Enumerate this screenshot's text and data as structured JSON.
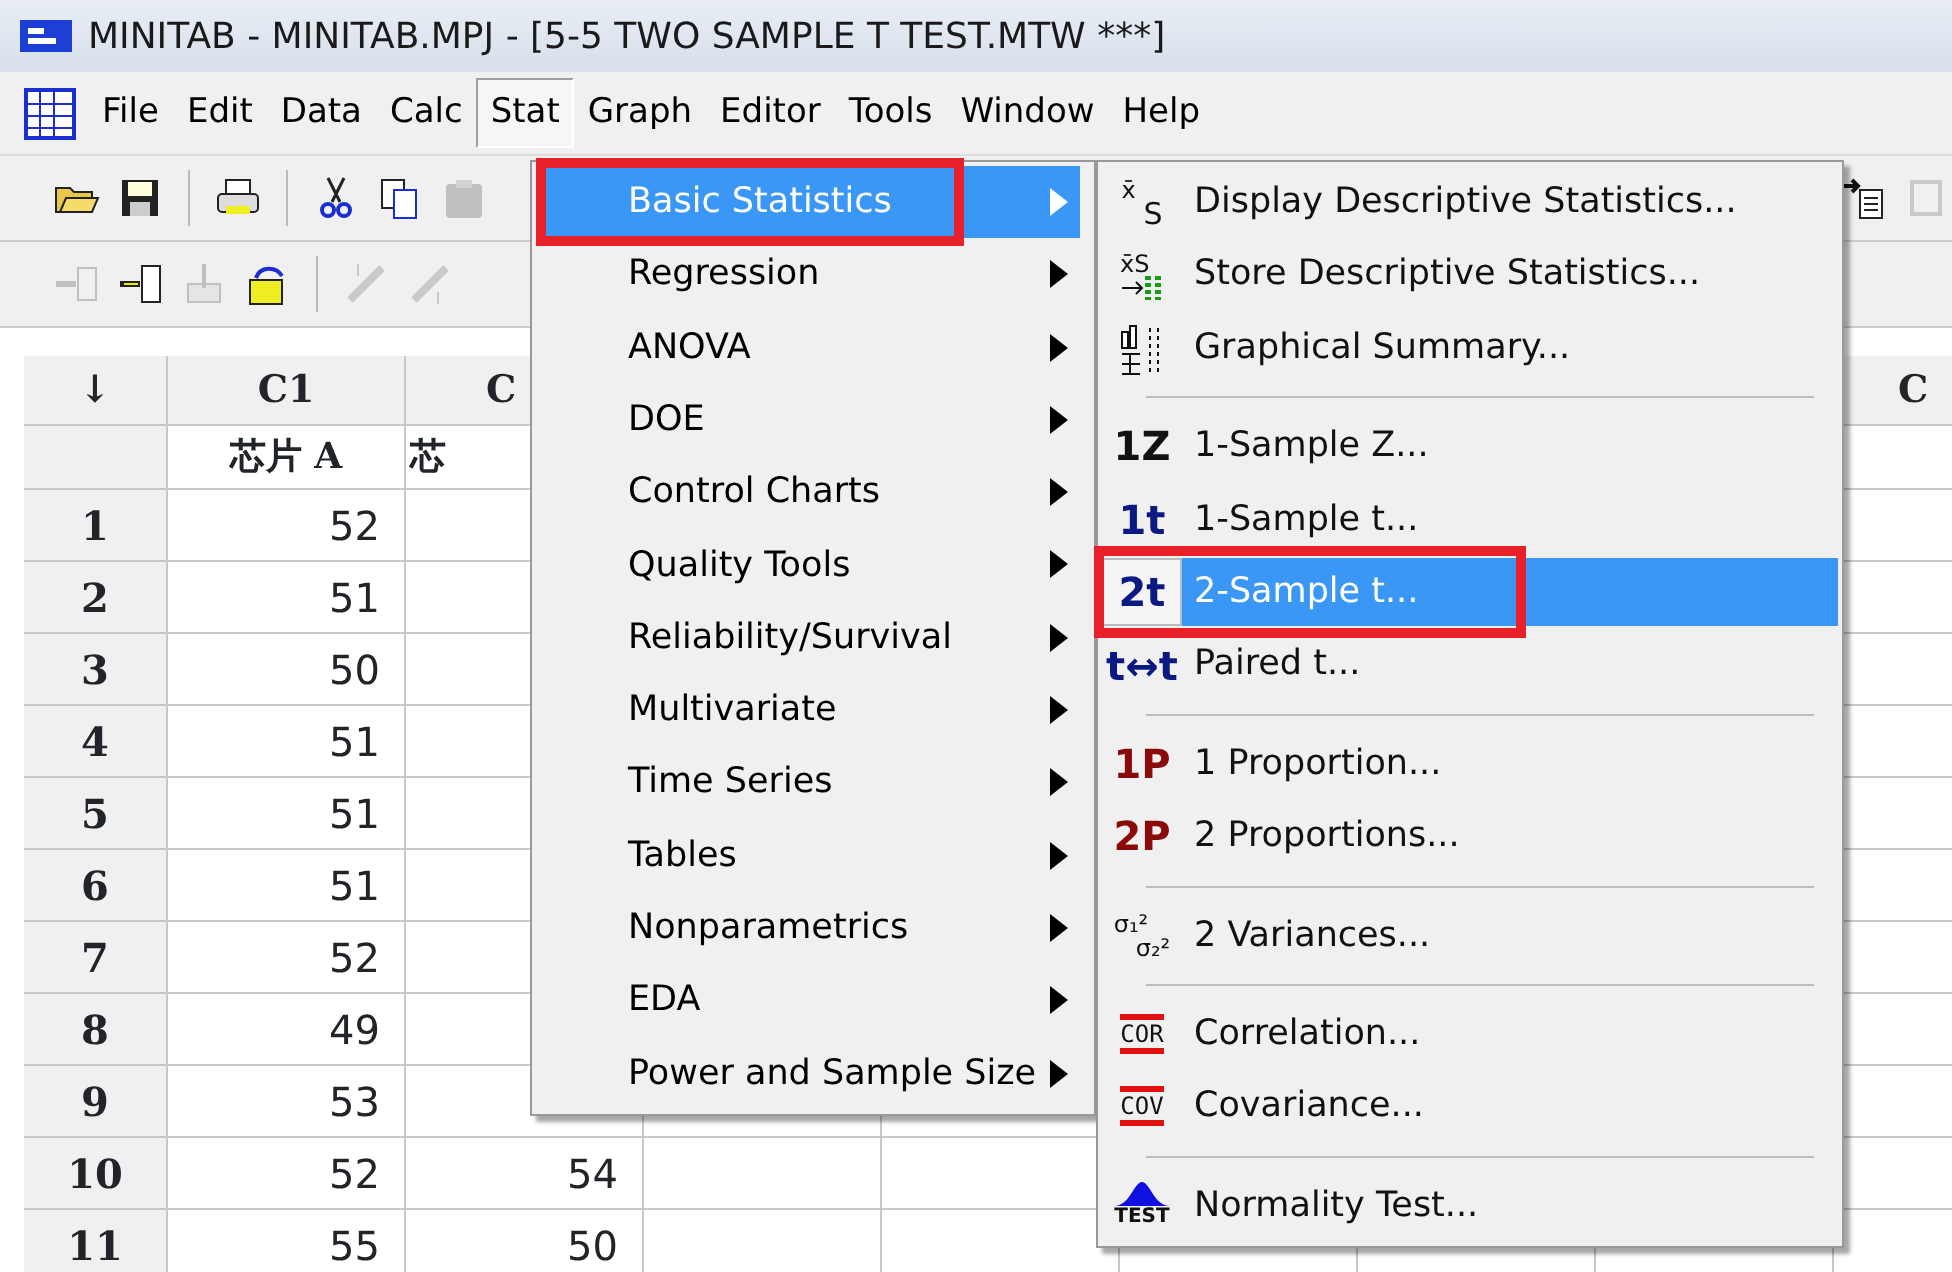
{
  "window": {
    "title": "MINITAB - MINITAB.MPJ - [5-5 TWO SAMPLE T TEST.MTW ***]"
  },
  "menubar": [
    {
      "label": "File",
      "selected": false
    },
    {
      "label": "Edit",
      "selected": false
    },
    {
      "label": "Data",
      "selected": false
    },
    {
      "label": "Calc",
      "selected": false
    },
    {
      "label": "Stat",
      "selected": true
    },
    {
      "label": "Graph",
      "selected": false
    },
    {
      "label": "Editor",
      "selected": false
    },
    {
      "label": "Tools",
      "selected": false
    },
    {
      "label": "Window",
      "selected": false
    },
    {
      "label": "Help",
      "selected": false
    }
  ],
  "toolbar_1": [
    {
      "kind": "open",
      "disabled": false
    },
    {
      "kind": "save",
      "disabled": false
    },
    {
      "kind": "separator"
    },
    {
      "kind": "print",
      "disabled": false
    },
    {
      "kind": "separator"
    },
    {
      "kind": "cut",
      "disabled": false
    },
    {
      "kind": "copy",
      "disabled": false
    },
    {
      "kind": "paste",
      "disabled": true
    }
  ],
  "toolbar_1_right": [
    {
      "kind": "output",
      "disabled": false
    },
    {
      "kind": "frame",
      "disabled": true
    }
  ],
  "toolbar_2": [
    {
      "kind": "insert-row",
      "disabled": true
    },
    {
      "kind": "insert-column",
      "disabled": false
    },
    {
      "kind": "move-down",
      "disabled": true
    },
    {
      "kind": "rotate",
      "disabled": false
    },
    {
      "kind": "separator"
    },
    {
      "kind": "link-up",
      "disabled": true
    },
    {
      "kind": "link-down",
      "disabled": true
    }
  ],
  "worksheet": {
    "corner": "↓",
    "columns": [
      {
        "header": "C1",
        "name": "芯片 A"
      },
      {
        "header": "C",
        "name": "芯"
      },
      {},
      {},
      {},
      {},
      {},
      {
        "header": "C"
      }
    ],
    "rows": [
      {
        "number": "1",
        "cells": [
          "52"
        ]
      },
      {
        "number": "2",
        "cells": [
          "51"
        ]
      },
      {
        "number": "3",
        "cells": [
          "50"
        ]
      },
      {
        "number": "4",
        "cells": [
          "51"
        ]
      },
      {
        "number": "5",
        "cells": [
          "51"
        ]
      },
      {
        "number": "6",
        "cells": [
          "51"
        ]
      },
      {
        "number": "7",
        "cells": [
          "52"
        ]
      },
      {
        "number": "8",
        "cells": [
          "49"
        ]
      },
      {
        "number": "9",
        "cells": [
          "53"
        ]
      },
      {
        "number": "10",
        "cells": [
          "52",
          "54"
        ]
      },
      {
        "number": "11",
        "cells": [
          "55",
          "50"
        ]
      }
    ]
  },
  "stat_menu": [
    {
      "label": "Basic Statistics",
      "selected": true,
      "has_submenu": true,
      "callout": true
    },
    {
      "label": "Regression",
      "selected": false,
      "has_submenu": true,
      "callout": false
    },
    {
      "label": "ANOVA",
      "selected": false,
      "has_submenu": true,
      "callout": false
    },
    {
      "label": "DOE",
      "selected": false,
      "has_submenu": true,
      "callout": false
    },
    {
      "label": "Control Charts",
      "selected": false,
      "has_submenu": true,
      "callout": false
    },
    {
      "label": "Quality Tools",
      "selected": false,
      "has_submenu": true,
      "callout": false
    },
    {
      "label": "Reliability/Survival",
      "selected": false,
      "has_submenu": true,
      "callout": false
    },
    {
      "label": "Multivariate",
      "selected": false,
      "has_submenu": true,
      "callout": false
    },
    {
      "label": "Time Series",
      "selected": false,
      "has_submenu": true,
      "callout": false
    },
    {
      "label": "Tables",
      "selected": false,
      "has_submenu": true,
      "callout": false
    },
    {
      "label": "Nonparametrics",
      "selected": false,
      "has_submenu": true,
      "callout": false
    },
    {
      "label": "EDA",
      "selected": false,
      "has_submenu": true,
      "callout": false
    },
    {
      "label": "Power and Sample Size",
      "selected": false,
      "has_submenu": true,
      "callout": false
    }
  ],
  "basic_statistics_menu": [
    {
      "kind": "display",
      "glyph": "x̄",
      "glyph_2": "S",
      "label": "Display Descriptive Statistics...",
      "selected": false,
      "callout": false
    },
    {
      "kind": "store",
      "glyph": "x̄S",
      "label": "Store Descriptive Statistics...",
      "selected": false,
      "callout": false
    },
    {
      "kind": "graphical",
      "label": "Graphical Summary...",
      "selected": false,
      "callout": false
    },
    {
      "kind": "separator"
    },
    {
      "kind": "glyph",
      "glyph": "1Z",
      "color": "#111111",
      "label": "1-Sample Z...",
      "selected": false,
      "callout": false
    },
    {
      "kind": "glyph",
      "glyph": "1t",
      "color": "#0a1a80",
      "label": "1-Sample t...",
      "selected": false,
      "callout": false
    },
    {
      "kind": "glyph",
      "glyph": "2t",
      "color": "#0a1a80",
      "label": "2-Sample t...",
      "selected": true,
      "callout": true
    },
    {
      "kind": "glyph",
      "glyph": "t↔t",
      "color": "#0a1a80",
      "label": "Paired t...",
      "selected": false,
      "callout": false
    },
    {
      "kind": "separator"
    },
    {
      "kind": "glyph",
      "glyph": "1P",
      "color": "#8a0a0a",
      "label": "1 Proportion...",
      "selected": false,
      "callout": false
    },
    {
      "kind": "glyph",
      "glyph": "2P",
      "color": "#8a0a0a",
      "label": "2 Proportions...",
      "selected": false,
      "callout": false
    },
    {
      "kind": "separator"
    },
    {
      "kind": "variances",
      "glyph": "σ₁²",
      "glyph_2": "σ₂²",
      "label": "2 Variances...",
      "selected": false,
      "callout": false
    },
    {
      "kind": "separator"
    },
    {
      "kind": "boxed",
      "glyph": "COR",
      "label": "Correlation...",
      "selected": false,
      "callout": false
    },
    {
      "kind": "boxed",
      "glyph": "COV",
      "label": "Covariance...",
      "selected": false,
      "callout": false
    },
    {
      "kind": "separator"
    },
    {
      "kind": "normality",
      "glyph": "TEST",
      "label": "Normality Test...",
      "selected": false,
      "callout": false
    }
  ]
}
